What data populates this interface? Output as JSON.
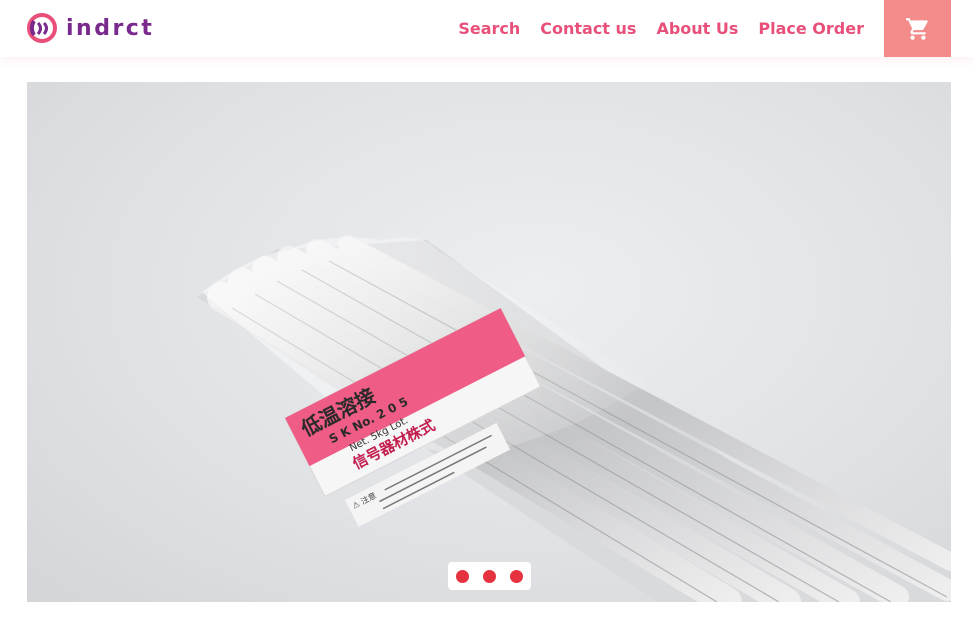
{
  "brand": {
    "name": "indrct"
  },
  "nav": {
    "items": [
      {
        "label": "Search"
      },
      {
        "label": "Contact us"
      },
      {
        "label": "About Us"
      },
      {
        "label": "Place Order"
      }
    ]
  },
  "cart": {
    "icon": "shopping-cart-icon"
  },
  "hero": {
    "label": {
      "title": "低温溶接",
      "line1": "S K  No. 2 0 5",
      "line2": "Net. 5kg  Lot.",
      "company": "信号器材株式",
      "warning": "⚠ 注意"
    }
  },
  "carousel": {
    "slides": 3
  },
  "colors": {
    "brand_purple": "#7a2a8c",
    "nav_pink": "#e8507a",
    "cart_bg": "#f48b8b",
    "dot_red": "#e5323e"
  }
}
